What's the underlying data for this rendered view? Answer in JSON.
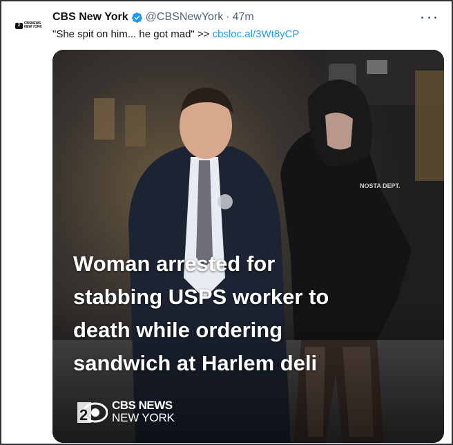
{
  "account": {
    "display_name": "CBS New York",
    "handle": "@CBSNewYork",
    "separator": "·",
    "time": "47m",
    "avatar_text_1": "CBSNEWS",
    "avatar_text_2": "NEW YORK",
    "avatar_number": "2",
    "verified_color": "#1d9bf0"
  },
  "tweet": {
    "text": "\"She spit on him... he got mad\" >> ",
    "link_text": "cbsloc.al/3Wt8yCP"
  },
  "media": {
    "headline_lines": [
      "Woman arrested for",
      "stabbing USPS worker to",
      "death while ordering",
      "sandwich at Harlem deli"
    ],
    "logo_number": "2",
    "logo_line_1": "CBS NEWS",
    "logo_line_2": "NEW YORK",
    "sweatshirt_text": "NOSTA DEPT."
  },
  "icons": {
    "more": "more-options-icon",
    "verified": "verified-badge-icon"
  },
  "colors": {
    "link": "#1d9bf0",
    "secondary_text": "#536471",
    "primary_text": "#0f1419"
  }
}
